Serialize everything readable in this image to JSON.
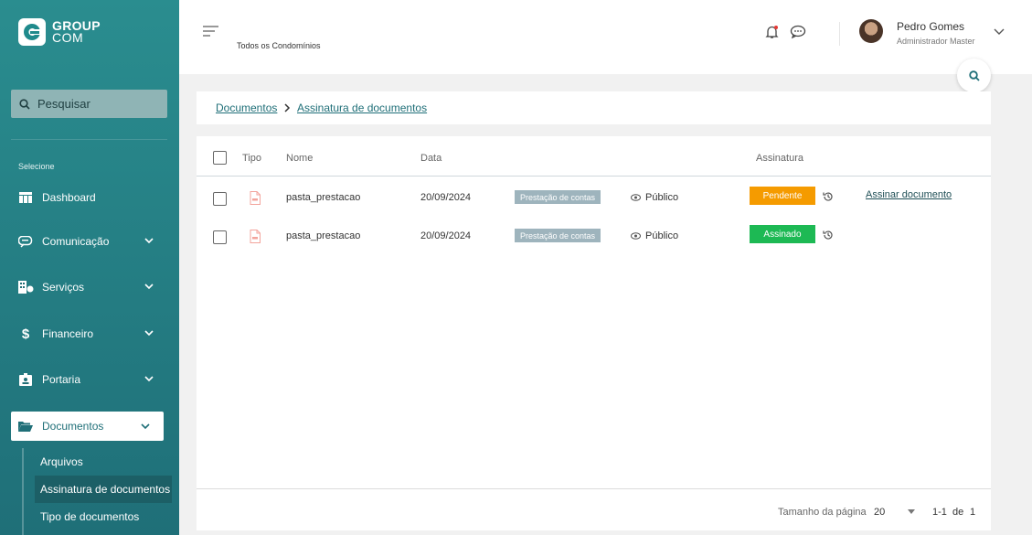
{
  "brand": {
    "line1": "GROUP",
    "line2": "COM"
  },
  "sidebar": {
    "search_placeholder": "Pesquisar",
    "section_label": "Selecione",
    "items": [
      {
        "label": "Dashboard"
      },
      {
        "label": "Comunicação"
      },
      {
        "label": "Serviços"
      },
      {
        "label": "Financeiro"
      },
      {
        "label": "Portaria"
      },
      {
        "label": "Documentos"
      }
    ],
    "subitems": [
      {
        "label": "Arquivos"
      },
      {
        "label": "Assinatura de documentos"
      },
      {
        "label": "Tipo de documentos"
      }
    ]
  },
  "header": {
    "condo_label": "Todos os Condomínios",
    "user_name": "Pedro Gomes",
    "user_role": "Administrador Master"
  },
  "breadcrumb": {
    "root": "Documentos",
    "current": "Assinatura de documentos"
  },
  "table": {
    "headers": {
      "type": "Tipo",
      "name": "Nome",
      "date": "Data",
      "signature": "Assinatura"
    },
    "rows": [
      {
        "name": "pasta_prestacao",
        "date": "20/09/2024",
        "category": "Prestação de contas",
        "visibility": "Público",
        "status": "Pendente",
        "status_color": "#f59b00",
        "action": "Assinar documento"
      },
      {
        "name": "pasta_prestacao",
        "date": "20/09/2024",
        "category": "Prestação de contas",
        "visibility": "Público",
        "status": "Assinado",
        "status_color": "#1db954",
        "action": ""
      }
    ]
  },
  "pagination": {
    "page_size_label": "Tamanho da página",
    "page_size": "20",
    "range": "1-1",
    "of_label": "de",
    "total": "1"
  },
  "colors": {
    "sidebar_top": "#2a8d8f",
    "sidebar_bottom": "#1f6f78",
    "pending": "#f59b00",
    "signed": "#1db954"
  }
}
